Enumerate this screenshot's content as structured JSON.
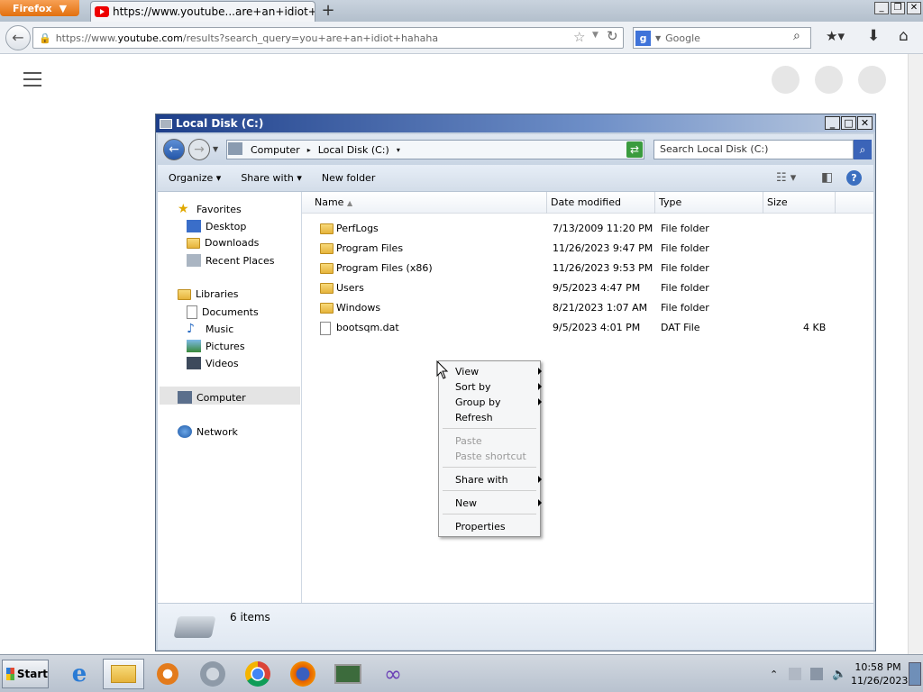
{
  "browser": {
    "menu_button": "Firefox",
    "tab_title": "https://www.youtube...are+an+idiot+hahaha",
    "new_tab": "+",
    "url_prefix": "https://www.",
    "url_domain": "youtube.com",
    "url_path": "/results?search_query=you+are+an+idiot+hahaha",
    "search_placeholder": "Google"
  },
  "explorer": {
    "title": "Local Disk (C:)",
    "breadcrumb": [
      "Computer",
      "Local Disk (C:)"
    ],
    "search_placeholder": "Search Local Disk (C:)",
    "toolbar": {
      "organize": "Organize",
      "share_with": "Share with",
      "new_folder": "New folder"
    },
    "nav": {
      "favorites": "Favorites",
      "desktop": "Desktop",
      "downloads": "Downloads",
      "recent_places": "Recent Places",
      "libraries": "Libraries",
      "documents": "Documents",
      "music": "Music",
      "pictures": "Pictures",
      "videos": "Videos",
      "computer": "Computer",
      "network": "Network"
    },
    "columns": {
      "name": "Name",
      "date": "Date modified",
      "type": "Type",
      "size": "Size"
    },
    "files": [
      {
        "name": "PerfLogs",
        "date": "7/13/2009 11:20 PM",
        "type": "File folder",
        "size": "",
        "kind": "folder"
      },
      {
        "name": "Program Files",
        "date": "11/26/2023 9:47 PM",
        "type": "File folder",
        "size": "",
        "kind": "folder"
      },
      {
        "name": "Program Files (x86)",
        "date": "11/26/2023 9:53 PM",
        "type": "File folder",
        "size": "",
        "kind": "folder"
      },
      {
        "name": "Users",
        "date": "9/5/2023 4:47 PM",
        "type": "File folder",
        "size": "",
        "kind": "folder"
      },
      {
        "name": "Windows",
        "date": "8/21/2023 1:07 AM",
        "type": "File folder",
        "size": "",
        "kind": "folder"
      },
      {
        "name": "bootsqm.dat",
        "date": "9/5/2023 4:01 PM",
        "type": "DAT File",
        "size": "4 KB",
        "kind": "file"
      }
    ],
    "status": "6 items"
  },
  "context_menu": {
    "view": "View",
    "sort_by": "Sort by",
    "group_by": "Group by",
    "refresh": "Refresh",
    "paste": "Paste",
    "paste_shortcut": "Paste shortcut",
    "share_with": "Share with",
    "new": "New",
    "properties": "Properties"
  },
  "taskbar": {
    "start": "Start",
    "time": "10:58 PM",
    "date": "11/26/2023"
  },
  "icons": [
    "firefox-icon",
    "youtube-icon",
    "back-icon",
    "lock-icon",
    "star-icon",
    "refresh-icon",
    "google-icon",
    "search-icon",
    "bookmarks-icon",
    "download-icon",
    "home-icon",
    "hamburger-icon",
    "folder-icon",
    "file-icon",
    "ie-icon",
    "explorer-icon",
    "chrome-icon"
  ],
  "colors": {
    "title_bar": "#1e3f8a",
    "firefox_orange": "#e2700e"
  }
}
